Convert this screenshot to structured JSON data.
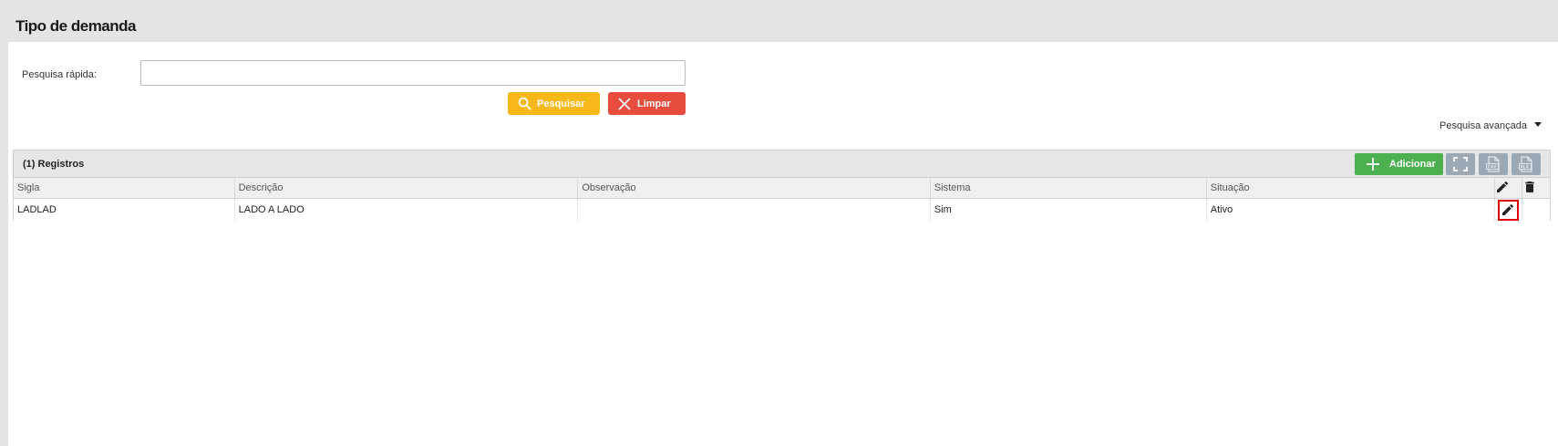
{
  "page": {
    "title": "Tipo de demanda"
  },
  "search": {
    "label": "Pesquisa rápida:",
    "value": "",
    "placeholder": "",
    "search_button": "Pesquisar",
    "clear_button": "Limpar",
    "advanced": "Pesquisa avançada"
  },
  "panel": {
    "count_label": "(1) Registros",
    "add_button": "Adicionar",
    "tool_icons": [
      "fullscreen-icon",
      "csv-export-icon",
      "xls-export-icon"
    ]
  },
  "table": {
    "columns": [
      "Sigla",
      "Descrição",
      "Observação",
      "Sistema",
      "Situação"
    ],
    "rows": [
      {
        "sigla": "LADLAD",
        "descricao": "LADO A LADO",
        "observacao": "",
        "sistema": "Sim",
        "situacao": "Ativo"
      }
    ]
  },
  "colors": {
    "search_button": "#f6b919",
    "clear_button": "#e74c3c",
    "add_button": "#4caf50",
    "tool_button": "#9aa9b3",
    "highlight_box": "#e00000"
  }
}
